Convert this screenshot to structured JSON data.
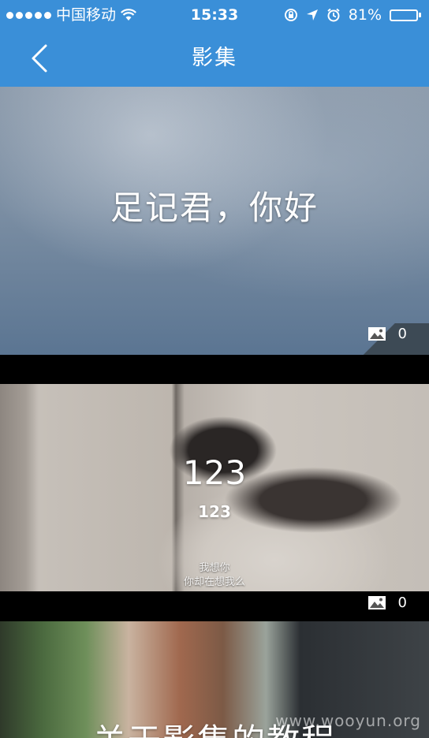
{
  "status_bar": {
    "carrier": "中国移动",
    "time": "15:33",
    "battery": "81%",
    "battery_level": 0.81
  },
  "nav": {
    "title": "影集"
  },
  "albums": [
    {
      "title": "足记君，你好",
      "photo_count": "0"
    },
    {
      "title": "123",
      "subtitle": "123",
      "caption_line1": "我想你",
      "caption_line2": "你却在想我么",
      "photo_count": "0"
    },
    {
      "title": "关于影集的教程"
    }
  ],
  "watermark": "www.wooyun.org",
  "colors": {
    "brand_blue": "#3a8fd8"
  }
}
